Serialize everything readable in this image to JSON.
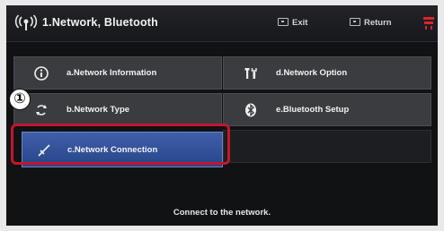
{
  "header": {
    "title": "1.Network, Bluetooth",
    "exit_label": "Exit",
    "return_label": "Return"
  },
  "menu": {
    "items": [
      {
        "label": "a.Network Information",
        "icon": "info-icon",
        "selected": false
      },
      {
        "label": "b.Network Type",
        "icon": "network-type-icon",
        "selected": false
      },
      {
        "label": "c.Network Connection",
        "icon": "network-connection-icon",
        "selected": true
      },
      {
        "label": "d.Network Option",
        "icon": "tools-icon",
        "selected": false
      },
      {
        "label": "e.Bluetooth Setup",
        "icon": "bluetooth-icon",
        "selected": false
      }
    ]
  },
  "annotation": {
    "marker": "①",
    "highlight_color": "#c4162b"
  },
  "status": {
    "message": "Connect to the network."
  },
  "colors": {
    "background": "#111214",
    "tile": "#3a3c40",
    "selected_tile": "#2f4f9a",
    "text": "#f3f3f3"
  }
}
